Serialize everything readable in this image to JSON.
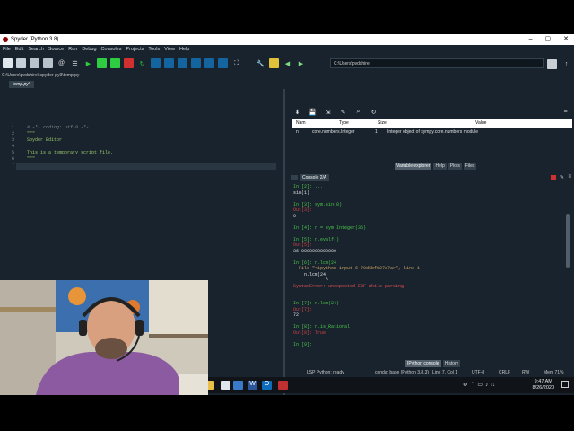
{
  "titlebar": {
    "title": "Spyder (Python 3.8)",
    "minimize": "–",
    "maximize": "▢",
    "close": "✕"
  },
  "menu": [
    "File",
    "Edit",
    "Search",
    "Source",
    "Run",
    "Debug",
    "Consoles",
    "Projects",
    "Tools",
    "View",
    "Help"
  ],
  "toolbar": {
    "working_dir": "C:\\Users\\pvdshire"
  },
  "editor": {
    "path": "C:\\Users\\pvdshire\\.spyder-py3\\temp.py",
    "tab": "temp.py*",
    "line_numbers": [
      "1",
      "2",
      "3",
      "4",
      "5",
      "6",
      "7"
    ],
    "lines": [
      {
        "text": "# -*- coding: utf-8 -*-",
        "cls": "cmt"
      },
      {
        "text": "\"\"\"",
        "cls": "str"
      },
      {
        "text": "Spyder Editor",
        "cls": "str"
      },
      {
        "text": "",
        "cls": ""
      },
      {
        "text": "This is a temporary script file.",
        "cls": "str"
      },
      {
        "text": "\"\"\"",
        "cls": "str"
      },
      {
        "text": "",
        "cls": ""
      }
    ]
  },
  "variable_explorer": {
    "headers": {
      "name": "Nam",
      "type": "Type",
      "size": "Size",
      "value": "Value"
    },
    "rows": [
      {
        "name": "n",
        "type": "core.numbers.Integer",
        "size": "1",
        "value": "Integer object of sympy.core.numbers module"
      }
    ],
    "tabs": [
      "Variable explorer",
      "Help",
      "Plots",
      "Files"
    ]
  },
  "console": {
    "tab": "Console 2/A",
    "lines": [
      {
        "text": "In [2]: ...",
        "cls": "in"
      },
      {
        "text": "sin(1)",
        "cls": ""
      },
      {
        "text": "",
        "cls": ""
      },
      {
        "text": "In [3]: sym.sin(0)",
        "cls": "in"
      },
      {
        "text": "Out[3]:",
        "cls": "out"
      },
      {
        "text": "0",
        "cls": ""
      },
      {
        "text": "",
        "cls": ""
      },
      {
        "text": "In [4]: n = sym.Integer(36)",
        "cls": "in"
      },
      {
        "text": "",
        "cls": ""
      },
      {
        "text": "In [5]: n.evalf()",
        "cls": "in"
      },
      {
        "text": "Out[5]:",
        "cls": "out"
      },
      {
        "text": "36.0000000000000",
        "cls": ""
      },
      {
        "text": "",
        "cls": ""
      },
      {
        "text": "In [6]: n.lcm(24",
        "cls": "in"
      },
      {
        "text": "  File \"<ipython-input-6-70d6bf827a7a>\", line 1",
        "cls": "fstr"
      },
      {
        "text": "    n.lcm(24",
        "cls": ""
      },
      {
        "text": "            ^",
        "cls": ""
      },
      {
        "text": "SyntaxError: unexpected EOF while parsing",
        "cls": "err"
      },
      {
        "text": "",
        "cls": ""
      },
      {
        "text": "",
        "cls": ""
      },
      {
        "text": "In [7]: n.lcm(24)",
        "cls": "in"
      },
      {
        "text": "Out[7]:",
        "cls": "out"
      },
      {
        "text": "72",
        "cls": ""
      },
      {
        "text": "",
        "cls": ""
      },
      {
        "text": "In [8]: n.is_Rational",
        "cls": "in"
      },
      {
        "text": "Out[8]: True",
        "cls": "out"
      },
      {
        "text": "",
        "cls": ""
      },
      {
        "text": "In [9]:",
        "cls": "in"
      }
    ],
    "tabs": [
      "IPython console",
      "History"
    ]
  },
  "statusbar": {
    "lsp": "LSP Python: ready",
    "conda": "conda: base (Python 3.8.3)",
    "position": "Line 7, Col 1",
    "encoding": "UTF-8",
    "eol": "CRLF",
    "perm": "RW",
    "mem": "Mem 71%"
  },
  "taskbar": {
    "time": "9:47 AM",
    "date": "8/26/2020"
  },
  "colors": {
    "bg": "#19232d",
    "prompt_in": "#49c448",
    "prompt_out": "#d04040",
    "accent": "#1464a0"
  }
}
